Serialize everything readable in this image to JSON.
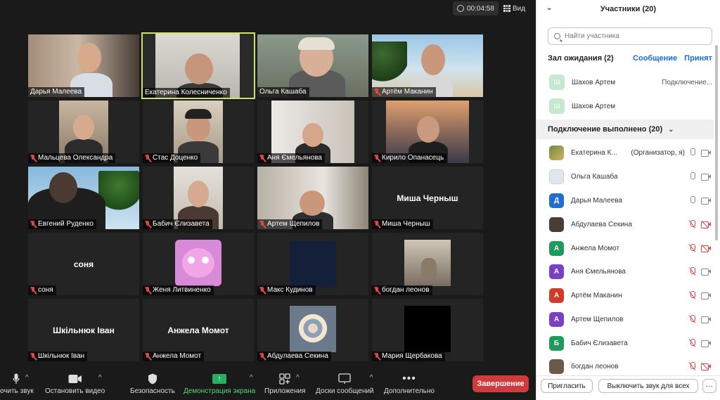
{
  "meeting": {
    "timer": "00:04:58",
    "view_label": "Вид"
  },
  "tiles": [
    {
      "name": "Дарья Малеева",
      "muted": false,
      "active": false,
      "center_name": ""
    },
    {
      "name": "Екатерина Колесниченко",
      "muted": false,
      "active": true,
      "center_name": ""
    },
    {
      "name": "Ольга Кашаба",
      "muted": false,
      "active": false,
      "center_name": ""
    },
    {
      "name": "Артём Маканин",
      "muted": true,
      "active": false,
      "center_name": ""
    },
    {
      "name": "Мальцева Олександра",
      "muted": true,
      "active": false,
      "center_name": ""
    },
    {
      "name": "Стас Доценко",
      "muted": true,
      "active": false,
      "center_name": ""
    },
    {
      "name": "Аня Ємельянова",
      "muted": true,
      "active": false,
      "center_name": ""
    },
    {
      "name": "Кирило Опанасець",
      "muted": true,
      "active": false,
      "center_name": ""
    },
    {
      "name": "Евгений Руденко",
      "muted": true,
      "active": false,
      "center_name": ""
    },
    {
      "name": "Бабич Єлизавета",
      "muted": true,
      "active": false,
      "center_name": ""
    },
    {
      "name": "Артем Щепилов",
      "muted": true,
      "active": false,
      "center_name": ""
    },
    {
      "name": "Миша Черныш",
      "muted": true,
      "active": false,
      "center_name": "Миша Черныш"
    },
    {
      "name": "соня",
      "muted": true,
      "active": false,
      "center_name": "соня"
    },
    {
      "name": "Женя Литвиненко",
      "muted": true,
      "active": false,
      "center_name": ""
    },
    {
      "name": "Макс Кудинов",
      "muted": true,
      "active": false,
      "center_name": ""
    },
    {
      "name": "богдан леонов",
      "muted": true,
      "active": false,
      "center_name": ""
    },
    {
      "name": "Шкільнюк Іван",
      "muted": true,
      "active": false,
      "center_name": "Шкільнюк Іван"
    },
    {
      "name": "Анжела Момот",
      "muted": true,
      "active": false,
      "center_name": "Анжела Момот"
    },
    {
      "name": "Абдулаева Секина",
      "muted": true,
      "active": false,
      "center_name": ""
    },
    {
      "name": "Мария Щербакова",
      "muted": true,
      "active": false,
      "center_name": ""
    }
  ],
  "toolbar": {
    "mute_label": "ючить звук",
    "video_label": "Остановить видео",
    "security_label": "Безопасность",
    "share_label": "Демонстрация экрана",
    "apps_label": "Приложения",
    "whiteboard_label": "Доски сообщений",
    "more_label": "Дополнительно",
    "end_label": "Завершение"
  },
  "panel": {
    "title": "Участники (20)",
    "search_placeholder": "Найти участника",
    "waiting_title": "Зал ожидания (2)",
    "message_link": "Сообщение",
    "admit_link": "Принят",
    "waiting": [
      {
        "initial": "Ш",
        "name": "Шахов Артем",
        "status": "Подключение..."
      },
      {
        "initial": "Ш",
        "name": "Шахов Артем",
        "status": ""
      }
    ],
    "connected_title": "Подключение выполнено (20)",
    "participants": [
      {
        "initial": "",
        "name": "Екатерина К...",
        "role": "(Организатор, я)",
        "mic": "on",
        "cam": "on",
        "color": "#6b8e3a"
      },
      {
        "initial": "",
        "name": "Ольга Кашаба",
        "role": "",
        "mic": "on",
        "cam": "on",
        "color": "#9fb4c8"
      },
      {
        "initial": "Д",
        "name": "Дарья Малеева",
        "role": "",
        "mic": "on",
        "cam": "on",
        "color": "#1f6fd1"
      },
      {
        "initial": "",
        "name": "Абдулаева Секина",
        "role": "",
        "mic": "off",
        "cam": "off",
        "color": "#5a4a3a"
      },
      {
        "initial": "А",
        "name": "Анжела Момот",
        "role": "",
        "mic": "off",
        "cam": "off",
        "color": "#1e9a5a"
      },
      {
        "initial": "А",
        "name": "Аня Ємельянова",
        "role": "",
        "mic": "off",
        "cam": "on",
        "color": "#7b3fc4"
      },
      {
        "initial": "А",
        "name": "Артём Маканин",
        "role": "",
        "mic": "off",
        "cam": "on",
        "color": "#d23a2a"
      },
      {
        "initial": "А",
        "name": "Артем Щепилов",
        "role": "",
        "mic": "off",
        "cam": "on",
        "color": "#7b3fc4"
      },
      {
        "initial": "Б",
        "name": "Бабич Єлизавета",
        "role": "",
        "mic": "off",
        "cam": "on",
        "color": "#1e9a5a"
      },
      {
        "initial": "",
        "name": "богдан леонов",
        "role": "",
        "mic": "off",
        "cam": "off",
        "color": "#6a5a4a"
      }
    ],
    "invite_label": "Пригласить",
    "mute_all_label": "Выключить звук для всех",
    "more_label": "···"
  }
}
